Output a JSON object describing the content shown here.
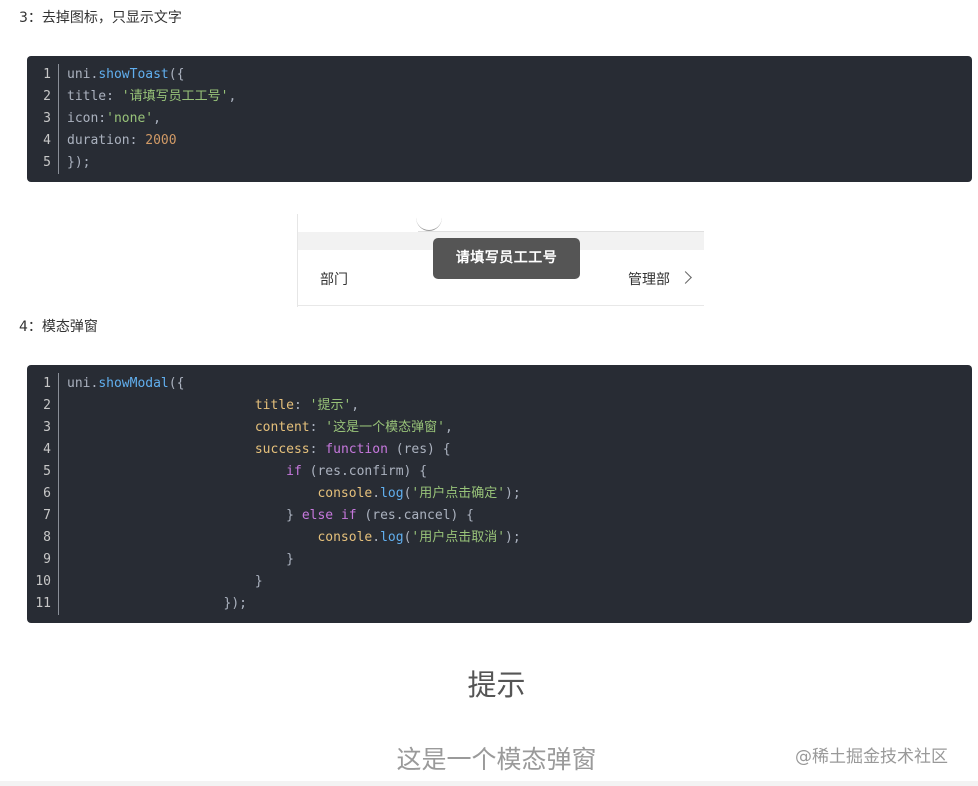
{
  "section3": {
    "heading": "3：去掉图标，只显示文字",
    "code": {
      "line_numbers": [
        "1",
        "2",
        "3",
        "4",
        "5"
      ],
      "lines": [
        [
          {
            "t": "uni.",
            "c": "plain"
          },
          {
            "t": "showToast",
            "c": "fn"
          },
          {
            "t": "({",
            "c": "plain"
          }
        ],
        [
          {
            "t": "title: ",
            "c": "plain"
          },
          {
            "t": "'请填写员工工号'",
            "c": "str"
          },
          {
            "t": ",",
            "c": "plain"
          }
        ],
        [
          {
            "t": "icon:",
            "c": "plain"
          },
          {
            "t": "'none'",
            "c": "str"
          },
          {
            "t": ",",
            "c": "plain"
          }
        ],
        [
          {
            "t": "duration: ",
            "c": "plain"
          },
          {
            "t": "2000",
            "c": "num"
          }
        ],
        [
          {
            "t": "});",
            "c": "plain"
          }
        ]
      ]
    },
    "preview": {
      "row_label": "部门",
      "row_value": "管理部",
      "toast_text": "请填写员工工号",
      "chevron_icon": "chevron-right-icon"
    }
  },
  "section4": {
    "heading": "4：模态弹窗",
    "code": {
      "line_numbers": [
        "1",
        "2",
        "3",
        "4",
        "5",
        "6",
        "7",
        "8",
        "9",
        "10",
        "11"
      ],
      "lines": [
        [
          {
            "t": "uni.",
            "c": "plain"
          },
          {
            "t": "showModal",
            "c": "fn"
          },
          {
            "t": "({",
            "c": "plain"
          }
        ],
        [
          {
            "t": "                        ",
            "c": "plain"
          },
          {
            "t": "title",
            "c": "prop"
          },
          {
            "t": ": ",
            "c": "plain"
          },
          {
            "t": "'提示'",
            "c": "str"
          },
          {
            "t": ",",
            "c": "plain"
          }
        ],
        [
          {
            "t": "                        ",
            "c": "plain"
          },
          {
            "t": "content",
            "c": "prop"
          },
          {
            "t": ": ",
            "c": "plain"
          },
          {
            "t": "'这是一个模态弹窗'",
            "c": "str"
          },
          {
            "t": ",",
            "c": "plain"
          }
        ],
        [
          {
            "t": "                        ",
            "c": "plain"
          },
          {
            "t": "success",
            "c": "prop"
          },
          {
            "t": ": ",
            "c": "plain"
          },
          {
            "t": "function",
            "c": "kw"
          },
          {
            "t": " (res) {",
            "c": "plain"
          }
        ],
        [
          {
            "t": "                            ",
            "c": "plain"
          },
          {
            "t": "if",
            "c": "kw"
          },
          {
            "t": " (res.confirm) {",
            "c": "plain"
          }
        ],
        [
          {
            "t": "                                ",
            "c": "plain"
          },
          {
            "t": "console",
            "c": "prop"
          },
          {
            "t": ".",
            "c": "plain"
          },
          {
            "t": "log",
            "c": "fn"
          },
          {
            "t": "(",
            "c": "plain"
          },
          {
            "t": "'用户点击确定'",
            "c": "str"
          },
          {
            "t": ");",
            "c": "plain"
          }
        ],
        [
          {
            "t": "                            ",
            "c": "plain"
          },
          {
            "t": "} ",
            "c": "plain"
          },
          {
            "t": "else",
            "c": "kw"
          },
          {
            "t": " ",
            "c": "plain"
          },
          {
            "t": "if",
            "c": "kw"
          },
          {
            "t": " (res.cancel) {",
            "c": "plain"
          }
        ],
        [
          {
            "t": "                                ",
            "c": "plain"
          },
          {
            "t": "console",
            "c": "prop"
          },
          {
            "t": ".",
            "c": "plain"
          },
          {
            "t": "log",
            "c": "fn"
          },
          {
            "t": "(",
            "c": "plain"
          },
          {
            "t": "'用户点击取消'",
            "c": "str"
          },
          {
            "t": ");",
            "c": "plain"
          }
        ],
        [
          {
            "t": "                            }",
            "c": "plain"
          }
        ],
        [
          {
            "t": "                        }",
            "c": "plain"
          }
        ],
        [
          {
            "t": "                    });",
            "c": "plain"
          }
        ]
      ]
    },
    "preview": {
      "modal_title": "提示",
      "modal_content": "这是一个模态弹窗"
    }
  },
  "watermark": "@稀土掘金技术社区",
  "colors": {
    "code_bg": "#282c34",
    "fn": "#61afef",
    "str": "#98c379",
    "num": "#d19a66",
    "kw": "#c678dd",
    "prop": "#e5c07b",
    "plain": "#abb2bf"
  }
}
